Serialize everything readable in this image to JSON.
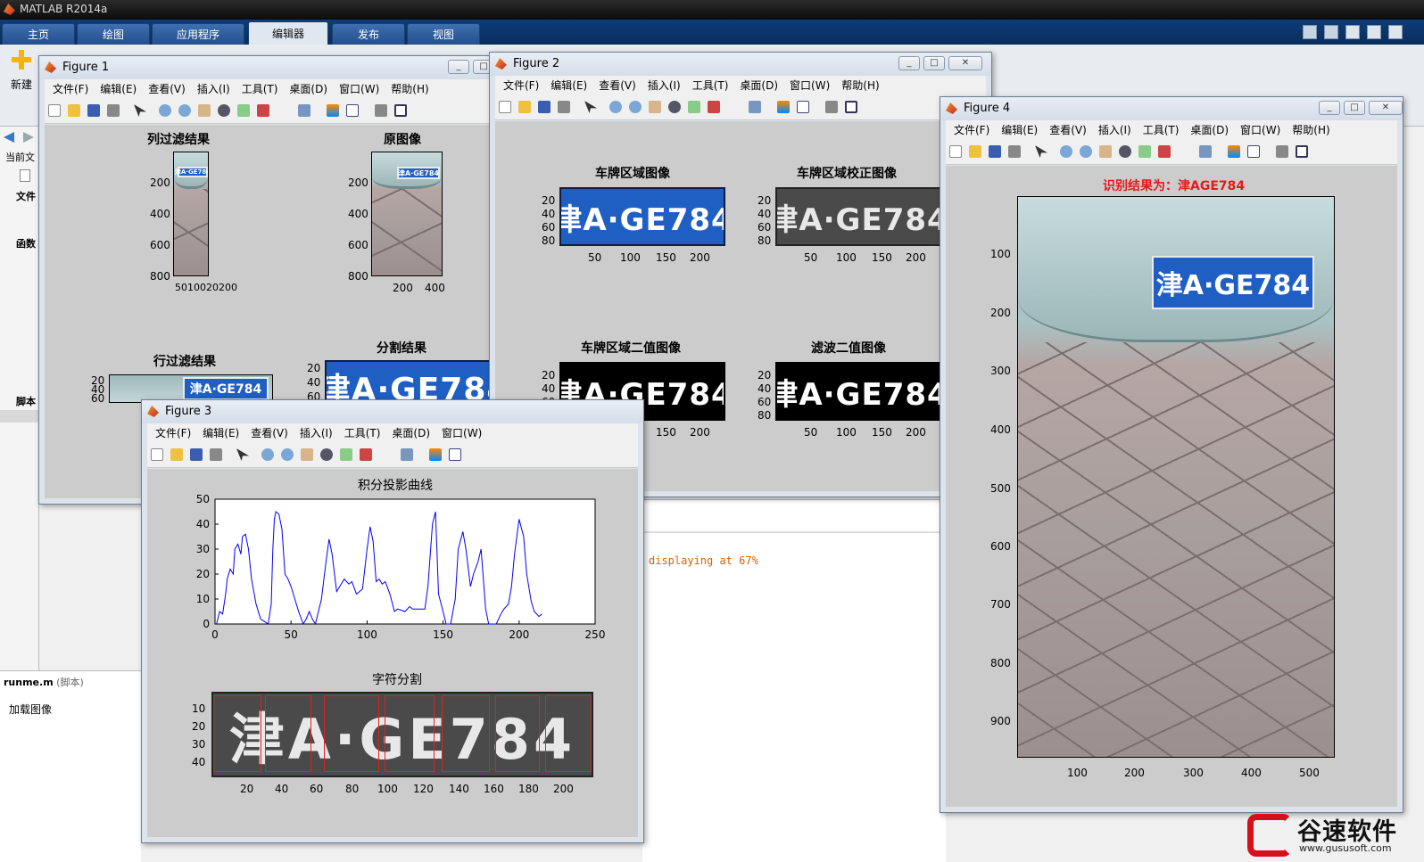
{
  "app": {
    "title": "MATLAB R2014a"
  },
  "ribbon": {
    "tabs": [
      {
        "label": "主页"
      },
      {
        "label": "绘图"
      },
      {
        "label": "应用程序"
      },
      {
        "label": "编辑器"
      },
      {
        "label": "发布"
      },
      {
        "label": "视图"
      }
    ],
    "new_label": "新建"
  },
  "left_panel": {
    "current_folder": "当前文",
    "files": "文件",
    "functions": "函数",
    "scripts": "脚本"
  },
  "script_panel": {
    "filename": "runme.m",
    "kind": "(脚本)",
    "line": "加载图像"
  },
  "console": {
    "text": "displaying at 67%"
  },
  "menu_items": [
    "文件(F)",
    "编辑(E)",
    "查看(V)",
    "插入(I)",
    "工具(T)",
    "桌面(D)",
    "窗口(W)",
    "帮助(H)"
  ],
  "fig1": {
    "title": "Figure 1",
    "panels": {
      "col_filter": "列过滤结果",
      "original": "原图像",
      "row_filter": "行过滤结果",
      "segment": "分割结果"
    },
    "col_yticks": [
      "200",
      "400",
      "600",
      "800"
    ],
    "col_xticks": "5010020200",
    "orig_yticks": [
      "200",
      "400",
      "600",
      "800"
    ],
    "orig_xticks": [
      "200",
      "400"
    ],
    "row_yticks": [
      "20",
      "40",
      "60"
    ],
    "seg_yticks": [
      "20",
      "40",
      "60"
    ]
  },
  "fig2": {
    "title": "Figure 2",
    "panels": {
      "region": "车牌区域图像",
      "corrected": "车牌区域校正图像",
      "binary": "车牌区域二值图像",
      "filtered": "滤波二值图像"
    },
    "yticks": [
      "20",
      "40",
      "60",
      "80"
    ],
    "xticks": [
      "50",
      "100",
      "150",
      "200"
    ]
  },
  "fig3": {
    "title": "Figure 3",
    "proj_title": "积分投影曲线",
    "seg_title": "字符分割",
    "seg_yticks": [
      "10",
      "20",
      "30",
      "40"
    ],
    "seg_xticks": [
      "20",
      "40",
      "60",
      "80",
      "100",
      "120",
      "140",
      "160",
      "180",
      "200"
    ]
  },
  "fig4": {
    "title": "Figure 4",
    "result": "识别结果为：津AGE784",
    "yticks": [
      "100",
      "200",
      "300",
      "400",
      "500",
      "600",
      "700",
      "800",
      "900"
    ],
    "xticks": [
      "100",
      "200",
      "300",
      "400",
      "500"
    ]
  },
  "plate_text": "津A·GE784",
  "chart_data": {
    "type": "line",
    "title": "积分投影曲线",
    "xlabel": "",
    "ylabel": "",
    "xlim": [
      0,
      250
    ],
    "ylim": [
      0,
      50
    ],
    "xticks": [
      0,
      50,
      100,
      150,
      200,
      250
    ],
    "yticks": [
      0,
      10,
      20,
      30,
      40,
      50
    ],
    "x": [
      1,
      3,
      5,
      7,
      8,
      10,
      12,
      13,
      15,
      17,
      18,
      20,
      22,
      24,
      27,
      30,
      35,
      37,
      38,
      39,
      40,
      42,
      44,
      46,
      48,
      50,
      55,
      58,
      60,
      62,
      64,
      66,
      70,
      73,
      75,
      77,
      80,
      82,
      85,
      88,
      90,
      93,
      95,
      97,
      100,
      102,
      104,
      106,
      108,
      110,
      112,
      115,
      118,
      120,
      125,
      128,
      130,
      133,
      135,
      138,
      140,
      143,
      145,
      147,
      150,
      152,
      155,
      158,
      160,
      163,
      165,
      168,
      170,
      173,
      175,
      178,
      180,
      183,
      185,
      188,
      190,
      193,
      195,
      197,
      200,
      203,
      205,
      208,
      210,
      213,
      215
    ],
    "y": [
      0,
      5,
      4,
      12,
      18,
      22,
      20,
      30,
      32,
      28,
      35,
      36,
      30,
      18,
      8,
      2,
      0,
      8,
      30,
      42,
      45,
      44,
      38,
      20,
      18,
      15,
      5,
      0,
      2,
      5,
      2,
      0,
      10,
      25,
      34,
      28,
      13,
      15,
      18,
      16,
      17,
      12,
      13,
      14,
      30,
      39,
      33,
      17,
      18,
      16,
      17,
      12,
      5,
      6,
      5,
      7,
      6,
      6,
      6,
      6,
      15,
      40,
      45,
      12,
      5,
      0,
      0,
      10,
      30,
      37,
      30,
      15,
      20,
      25,
      30,
      6,
      0,
      0,
      0,
      4,
      6,
      8,
      15,
      28,
      42,
      35,
      20,
      9,
      5,
      3,
      4
    ]
  },
  "watermark": {
    "brand": "谷速软件",
    "url": "www.gususoft.com"
  }
}
